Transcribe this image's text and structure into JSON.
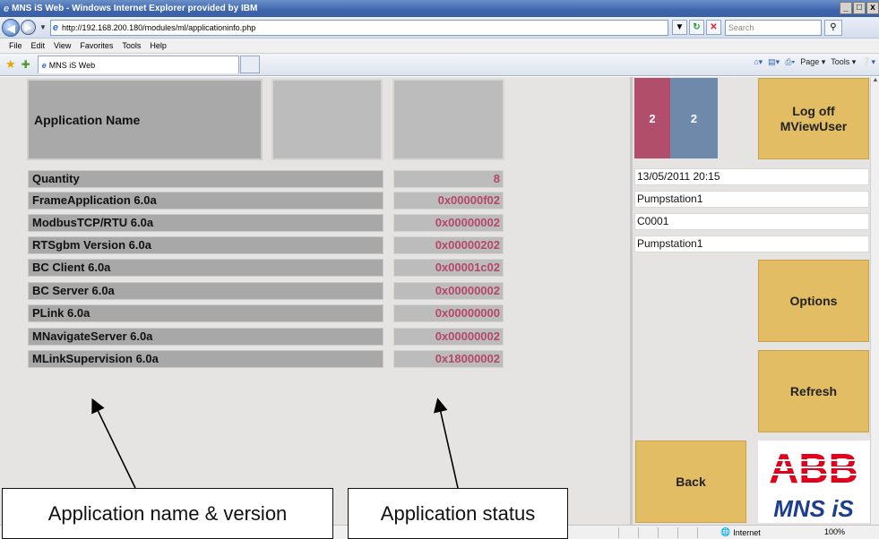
{
  "window": {
    "title": "MNS iS Web - Windows Internet Explorer provided by IBM",
    "buttons": [
      "_",
      "□",
      "x"
    ]
  },
  "browser": {
    "address": "http://192.168.200.180/modules/ml/applicationinfo.php",
    "search_placeholder": "Search",
    "menu": [
      "File",
      "Edit",
      "View",
      "Favorites",
      "Tools",
      "Help"
    ],
    "tab_title": "MNS iS Web",
    "commands": [
      "Page ▾",
      "Tools ▾"
    ],
    "status": {
      "zone": "Internet",
      "zoom": "100%"
    }
  },
  "app": {
    "header_label": "Application Name",
    "rows": [
      {
        "name": "Quantity",
        "value": "8"
      },
      {
        "name": "FrameApplication 6.0a",
        "value": "0x00000f02"
      },
      {
        "name": "ModbusTCP/RTU 6.0a",
        "value": "0x00000002"
      },
      {
        "name": "RTSgbm Version 6.0a",
        "value": "0x00000202"
      },
      {
        "name": "BC Client 6.0a",
        "value": "0x00001c02"
      },
      {
        "name": "BC Server 6.0a",
        "value": "0x00000002"
      },
      {
        "name": "PLink 6.0a",
        "value": "0x00000000"
      },
      {
        "name": "MNavigateServer 6.0a",
        "value": "0x00000002"
      },
      {
        "name": "MLinkSupervision 6.0a",
        "value": "0x18000002"
      }
    ]
  },
  "panel": {
    "count_red": "2",
    "count_blue": "2",
    "logoff_line1": "Log off",
    "logoff_line2": "MViewUser",
    "datetime": "13/05/2011 20:15",
    "info1": "Pumpstation1",
    "info2": "C0001",
    "info3": "Pumpstation1",
    "options": "Options",
    "refresh": "Refresh",
    "back": "Back",
    "logo_top": "ABB",
    "logo_bottom": "MNS iS",
    "colors": {
      "red": "#b04e6c",
      "blue": "#6f89ab",
      "yellow": "#e2bd63",
      "value_text": "#b5476a",
      "abb_red": "#e2001a",
      "mns_blue": "#1d3d8f"
    }
  },
  "annotations": {
    "left": "Application name & version",
    "right": "Application status"
  }
}
